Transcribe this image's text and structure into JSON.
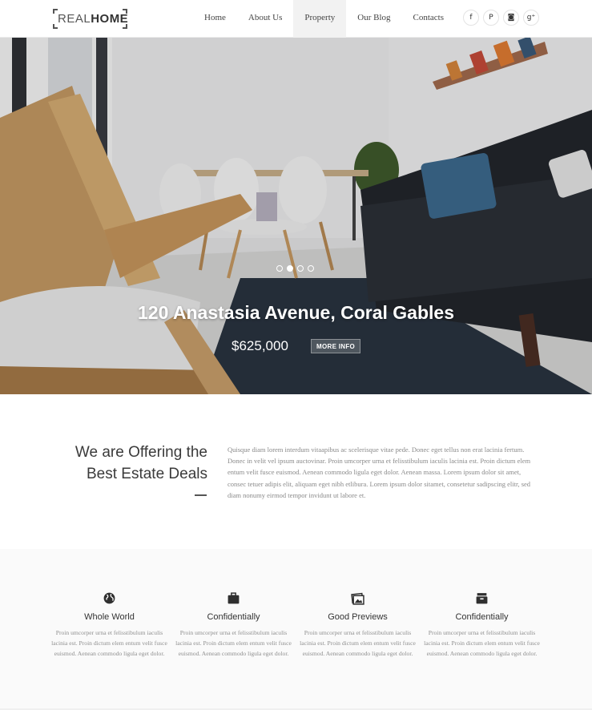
{
  "header": {
    "logo": {
      "light": "REAL",
      "bold": "HOME"
    },
    "nav": [
      {
        "label": "Home"
      },
      {
        "label": "About Us"
      },
      {
        "label": "Property"
      },
      {
        "label": "Our Blog"
      },
      {
        "label": "Contacts"
      }
    ],
    "active_nav": "Property",
    "socials": [
      {
        "name": "facebook-icon",
        "glyph": "f"
      },
      {
        "name": "pinterest-icon",
        "glyph": "P"
      },
      {
        "name": "instagram-icon",
        "glyph": "◙"
      },
      {
        "name": "google-plus-icon",
        "glyph": "g⁺"
      }
    ]
  },
  "hero": {
    "title": "120 Anastasia Avenue, Coral Gables",
    "price": "$625,000",
    "button_label": "MORE INFO",
    "slides": 4,
    "active_slide": 2
  },
  "intro": {
    "title_line1": "We are Offering the",
    "title_line2": "Best Estate Deals",
    "text": "Quisque diam lorem interdum vitaapibus ac scelerisque vitae pede. Donec eget tellus non erat lacinia fertum. Donec in velit vel ipsum auctovinar. Proin umcorper urna et felisstibulum iaculis lacinia est. Proin dictum elem entum velit fusce euismod. Aenean commodo ligula eget dolor. Aenean massa. Lorem ipsum dolor sit amet, consec tetuer adipis elit, aliquam eget nibh etlibura. Lorem ipsum dolor sitamet, consetetur sadipscing elitr, sed diam nonumy eirmod tempor invidunt ut labore et."
  },
  "features": [
    {
      "icon": "globe-icon",
      "title": "Whole World",
      "text": "Proin umcorper urna et felisstibulum iaculis lacinia est. Proin dictum elem entum velit fusce euismod. Aenean commodo ligula eget dolor."
    },
    {
      "icon": "briefcase-icon",
      "title": "Confidentially",
      "text": "Proin umcorper urna et felisstibulum iaculis lacinia est. Proin dictum elem entum velit fusce euismod. Aenean commodo ligula eget dolor."
    },
    {
      "icon": "pictures-icon",
      "title": "Good Previews",
      "text": "Proin umcorper urna et felisstibulum iaculis lacinia est. Proin dictum elem entum velit fusce euismod. Aenean commodo ligula eget dolor."
    },
    {
      "icon": "archive-icon",
      "title": "Confidentially",
      "text": "Proin umcorper urna et felisstibulum iaculis lacinia est. Proin dictum elem entum velit fusce euismod. Aenean commodo ligula eget dolor."
    }
  ],
  "colors": {
    "text_dark": "#333333",
    "text_muted": "#8a8a8a",
    "nav_active_bg": "#f2f2f2",
    "features_bg": "#fafafa"
  }
}
